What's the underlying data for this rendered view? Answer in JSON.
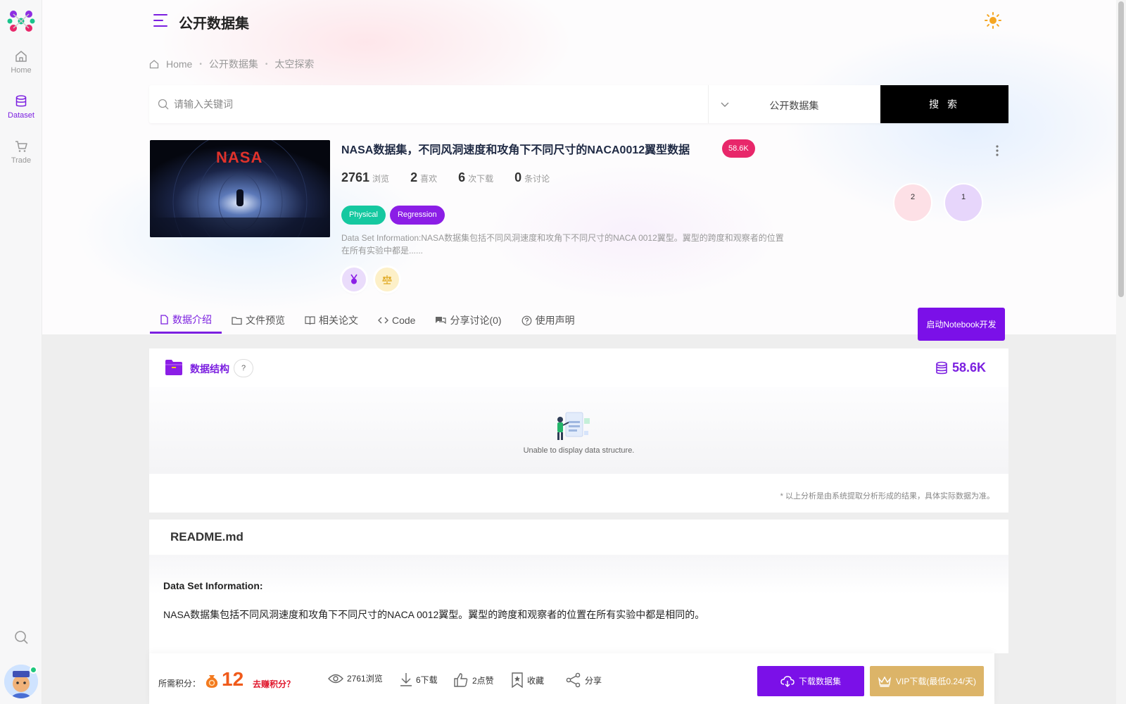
{
  "sidebar": {
    "items": [
      {
        "label": "Home",
        "icon": "home-icon"
      },
      {
        "label": "Dataset",
        "icon": "database-icon",
        "active": true
      },
      {
        "label": "Trade",
        "icon": "cart-icon"
      }
    ]
  },
  "header": {
    "title": "公开数据集"
  },
  "breadcrumb": [
    "Home",
    "公开数据集",
    "太空探索"
  ],
  "search": {
    "placeholder": "请输入关键词",
    "scope": "公开数据集",
    "button": "搜 索"
  },
  "dataset": {
    "title": "NASA数据集，不同风洞速度和攻角下不同尺寸的NACA0012翼型数据",
    "size_badge": "58.6K",
    "thumbnail_text": "NASA",
    "stats": [
      {
        "num": "2761",
        "label": "浏览"
      },
      {
        "num": "2",
        "label": "喜欢"
      },
      {
        "num": "6",
        "label": "次下载"
      },
      {
        "num": "0",
        "label": "条讨论"
      }
    ],
    "tags": [
      "Physical",
      "Regression"
    ],
    "description": "Data Set Information:NASA数据集包括不同风洞速度和攻角下不同尺寸的NACA 0012翼型。翼型的跨度和观察者的位置在所有实验中都是......",
    "votes": [
      "2",
      "1"
    ]
  },
  "tabs": [
    {
      "label": "数据介绍",
      "icon": "file-icon",
      "active": true
    },
    {
      "label": "文件预览",
      "icon": "folder-icon"
    },
    {
      "label": "相关论文",
      "icon": "book-icon"
    },
    {
      "label": "Code",
      "icon": "code-icon"
    },
    {
      "label": "分享讨论(0)",
      "icon": "chat-icon"
    },
    {
      "label": "使用声明",
      "icon": "question-icon"
    }
  ],
  "notebook_button": "启动Notebook开发",
  "structure": {
    "title": "数据结构",
    "help": "?",
    "size": "58.6K",
    "empty_text": "Unable to display data structure.",
    "note": "* 以上分析是由系统提取分析形成的结果，具体实际数据为准。"
  },
  "readme": {
    "title": "README.md",
    "heading": "Data Set Information:",
    "paragraph": "NASA数据集包括不同风洞速度和攻角下不同尺寸的NACA 0012翼型。翼型的跨度和观察者的位置在所有实验中都是相同的。"
  },
  "action_bar": {
    "points_label": "所需积分：",
    "points_value": "12",
    "earn_link": "去赚积分？",
    "views": "2761浏览",
    "downloads": "6下载",
    "likes": "2点赞",
    "favorite": "收藏",
    "share": "分享",
    "download_button": "下载数据集",
    "vip_button": "VIP下载(最低0.24/天)"
  },
  "colors": {
    "accent": "#7b1fe0",
    "badge": "#e8276a",
    "tag_green": "#15c8a0",
    "tag_purple": "#8b1ee6",
    "vip": "#dcb468"
  }
}
